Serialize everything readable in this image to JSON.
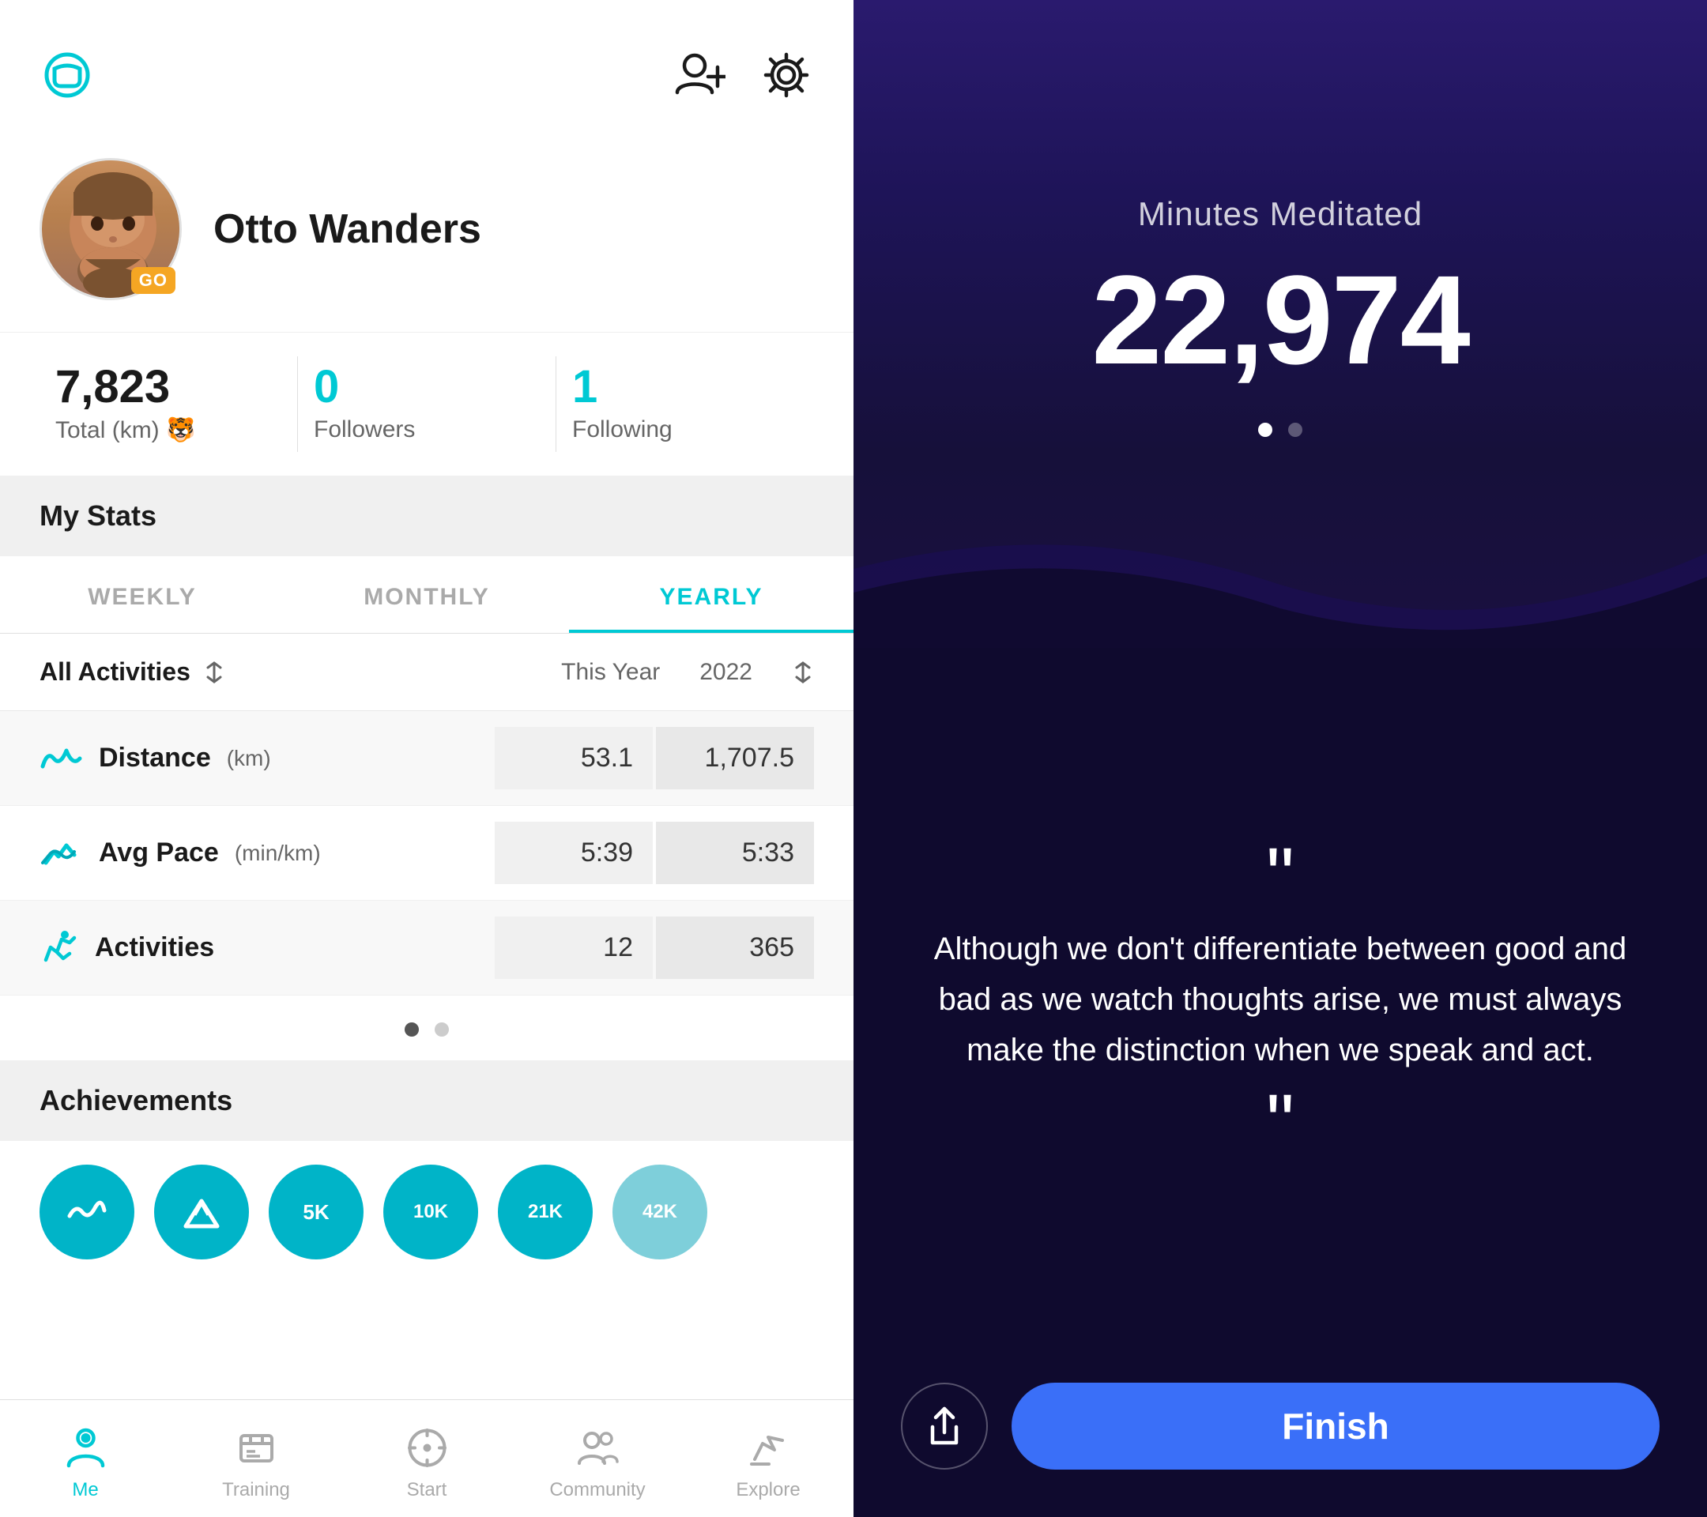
{
  "left": {
    "topBar": {
      "chatIcon": "chat-icon",
      "addUserIcon": "add-user-icon",
      "settingsIcon": "settings-icon"
    },
    "profile": {
      "name": "Otto Wanders",
      "goBadge": "GO"
    },
    "stats": {
      "totalKm": "7,823",
      "totalLabel": "Total (km) 🐯",
      "followers": "0",
      "followersLabel": "Followers",
      "following": "1",
      "followingLabel": "Following"
    },
    "myStats": {
      "header": "My Stats",
      "tabs": [
        "WEEKLY",
        "MONTHLY",
        "YEARLY"
      ],
      "activeTab": 2,
      "filterLabel": "All Activities",
      "col1": "This Year",
      "col2": "2022",
      "rows": [
        {
          "icon": "distance-icon",
          "label": "Distance",
          "unit": "(km)",
          "val1": "53.1",
          "val2": "1,707.5"
        },
        {
          "icon": "pace-icon",
          "label": "Avg Pace",
          "unit": "(min/km)",
          "val1": "5:39",
          "val2": "5:33"
        },
        {
          "icon": "run-icon",
          "label": "Activities",
          "unit": "",
          "val1": "12",
          "val2": "365"
        }
      ],
      "dots": [
        true,
        false
      ]
    },
    "achievements": {
      "header": "Achievements",
      "badges": [
        "wave",
        "mountain",
        "5K",
        "10K",
        "21K",
        "42K"
      ]
    },
    "bottomNav": [
      {
        "id": "me",
        "label": "Me",
        "active": true
      },
      {
        "id": "training",
        "label": "Training",
        "active": false
      },
      {
        "id": "start",
        "label": "Start",
        "active": false
      },
      {
        "id": "community",
        "label": "Community",
        "active": false
      },
      {
        "id": "explore",
        "label": "Explore",
        "active": false
      }
    ]
  },
  "right": {
    "meditationLabel": "Minutes Meditated",
    "meditationNumber": "22,974",
    "dots": [
      true,
      false
    ],
    "quote": "Although we don't differentiate between good and bad as we watch thoughts arise, we must always make the distinction when we speak and act.",
    "shareLabel": "share",
    "finishLabel": "Finish"
  }
}
